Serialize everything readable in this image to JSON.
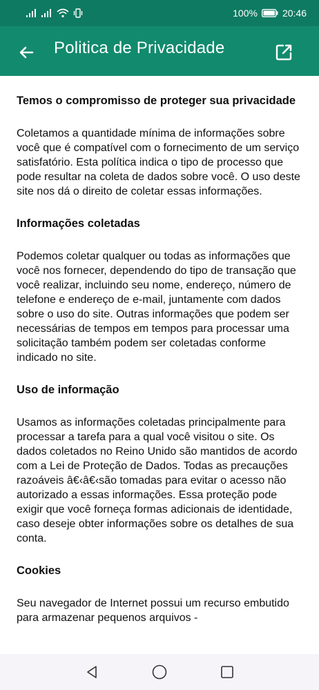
{
  "status": {
    "battery": "100%",
    "time": "20:46"
  },
  "header": {
    "title": "Politica de Privacidade",
    "back_icon": "arrow-left-icon",
    "open_icon": "open-in-new-icon",
    "background": "#128a6e"
  },
  "content": {
    "h1": "Temos o compromisso de proteger sua privacidade",
    "p1": "Coletamos a quantidade mínima de informações sobre você que é compatível com o fornecimento de um serviço satisfatório. Esta política indica o tipo de processo que pode resultar na coleta de dados sobre você. O uso deste site nos dá o direito de coletar essas informações.",
    "h2": "Informações coletadas",
    "p2": "Podemos coletar qualquer ou todas as informações que você nos fornecer, dependendo do tipo de transação que você realizar, incluindo seu nome, endereço, número de telefone e endereço de e-mail, juntamente com dados sobre o uso do site. Outras informações que podem ser necessárias de tempos em tempos para processar uma solicitação também podem ser coletadas conforme indicado no site.",
    "h3": "Uso de informação",
    "p3": "Usamos as informações coletadas principalmente para processar a tarefa para a qual você visitou o site. Os dados coletados no Reino Unido são mantidos de acordo com a Lei de Proteção de Dados. Todas as precauções razoáveis â€‹â€‹são tomadas para evitar o acesso não autorizado a essas informações. Essa proteção pode exigir que você forneça formas adicionais de identidade, caso deseje obter informações sobre os detalhes de sua conta.",
    "h4": "Cookies",
    "p4": "Seu navegador de Internet possui um recurso embutido para armazenar pequenos arquivos -"
  },
  "nav": {
    "back_icon": "triangle-back-icon",
    "home_icon": "circle-home-icon",
    "recents_icon": "square-recents-icon"
  }
}
